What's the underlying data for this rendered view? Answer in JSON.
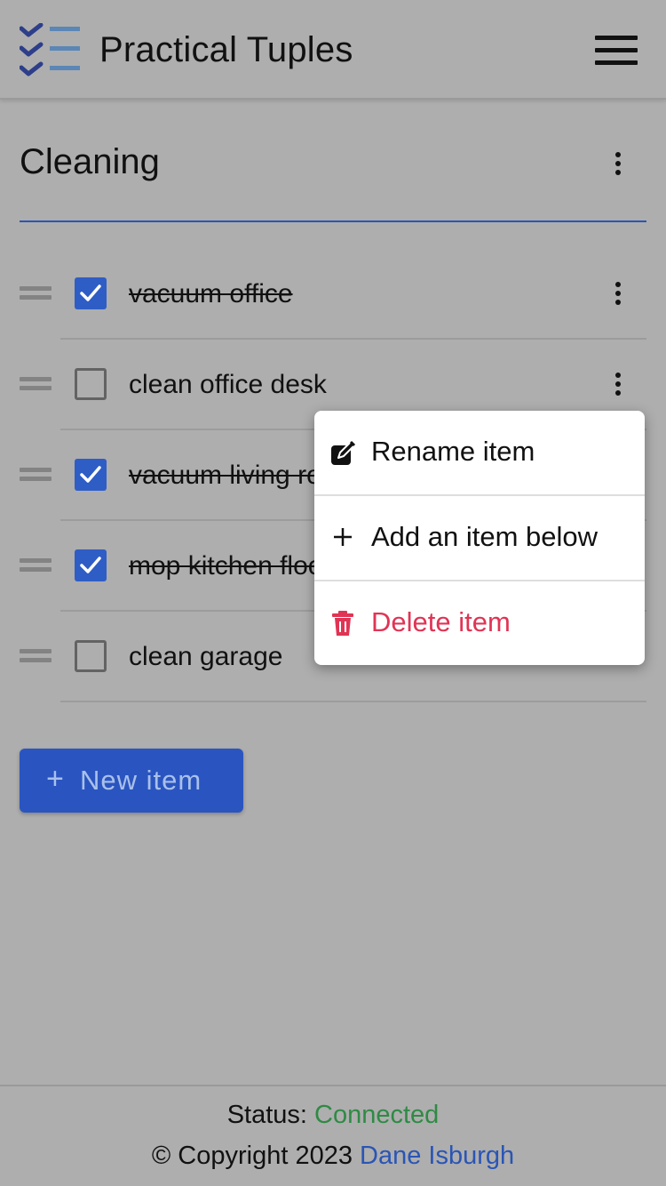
{
  "app": {
    "title": "Practical Tuples",
    "menu_icon": "hamburger-icon",
    "logo_icon": "checklist-logo-icon"
  },
  "list": {
    "title": "Cleaning",
    "menu_icon": "more-vert-icon",
    "items": [
      {
        "text": "vacuum office",
        "checked": true
      },
      {
        "text": "clean office desk",
        "checked": false
      },
      {
        "text": "vacuum living room",
        "checked": true
      },
      {
        "text": "mop kitchen floor",
        "checked": true
      },
      {
        "text": "clean garage",
        "checked": false
      }
    ]
  },
  "new_item": {
    "icon": "+",
    "label": "New item"
  },
  "context_menu": {
    "items": [
      {
        "label": "Rename item",
        "icon": "edit-icon"
      },
      {
        "label": "Add an item below",
        "icon": "plus-icon"
      },
      {
        "label": "Delete item",
        "icon": "trash-icon"
      }
    ]
  },
  "footer": {
    "status_label": "Status:",
    "status_value": "Connected",
    "copyright": "© Copyright 2023",
    "author": "Dane Isburgh"
  },
  "colors": {
    "background": "#aeaeae",
    "accent": "#2a55c0",
    "checkbox_checked": "#2f5dc6",
    "danger": "#e03454",
    "status_ok": "#2f8a45",
    "link": "#2a55b5"
  }
}
